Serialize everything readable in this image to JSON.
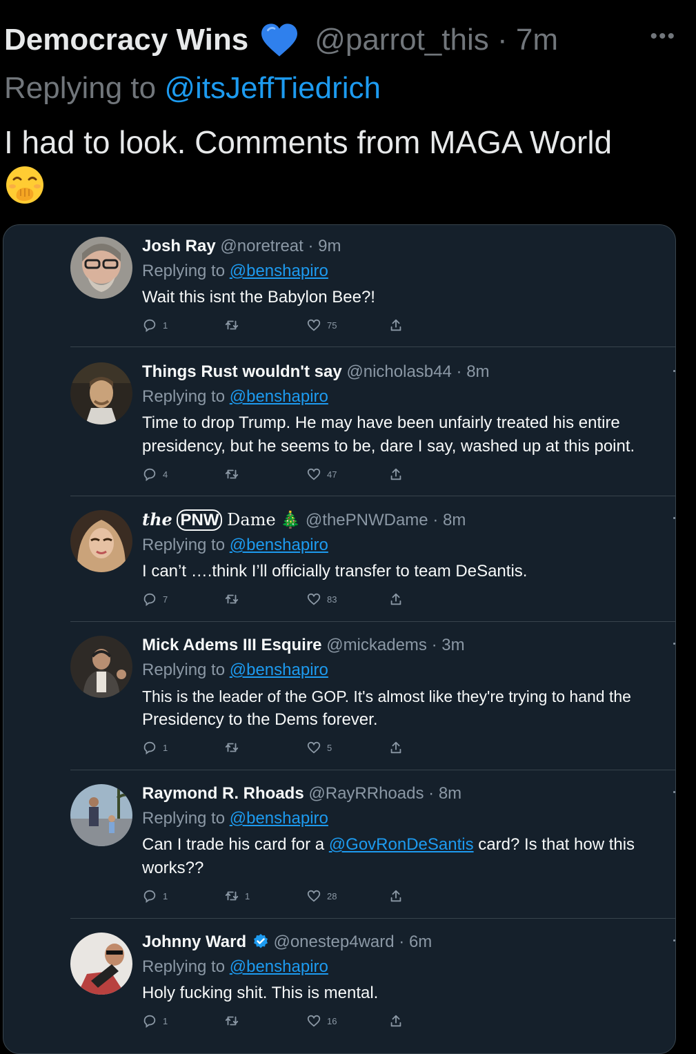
{
  "main_tweet": {
    "display_name": "Democracy Wins",
    "handle": "@parrot_this",
    "separator": "·",
    "time": "7m",
    "more": "•••",
    "replying_prefix": "Replying to",
    "replying_to": "@itsJeffTiedrich",
    "text": "I had to look. Comments from MAGA World",
    "heart_color": "#2f80ed",
    "emoji": "face-with-hand-over-mouth"
  },
  "replies": [
    {
      "name": "Josh Ray",
      "handle": "@noretreat",
      "time": "9m",
      "replying_prefix": "Replying to",
      "replying_to": "@benshapiro",
      "lines": [
        "Wait this isnt the Babylon Bee?!"
      ],
      "replies_count": "1",
      "retweets": "",
      "likes": "75"
    },
    {
      "name": "Things Rust wouldn't say",
      "handle": "@nicholasb44",
      "time": "8m",
      "replying_prefix": "Replying to",
      "replying_to": "@benshapiro",
      "lines": [
        "Time to drop Trump. He may have been unfairly treated his entire",
        "presidency, but he seems to be, dare I say,  washed up at this point."
      ],
      "replies_count": "4",
      "retweets": "",
      "likes": "47"
    },
    {
      "name_prefix": "the",
      "name_pnw": "PNW",
      "name_suffix": "Dame",
      "name_emoji": "🎄",
      "handle": "@thePNWDame",
      "time": "8m",
      "replying_prefix": "Replying to",
      "replying_to": "@benshapiro",
      "lines": [
        "I can’t ….think I’ll officially transfer to team DeSantis."
      ],
      "replies_count": "7",
      "retweets": "",
      "likes": "83"
    },
    {
      "name": "Mick Adems III Esquire",
      "handle": "@mickadems",
      "time": "3m",
      "replying_prefix": "Replying to",
      "replying_to": "@benshapiro",
      "lines": [
        "This is the leader of the GOP. It's almost like they're trying to hand the",
        "Presidency to the Dems forever."
      ],
      "replies_count": "1",
      "retweets": "",
      "likes": "5"
    },
    {
      "name": "Raymond R. Rhoads",
      "handle": "@RayRRhoads",
      "time": "8m",
      "replying_prefix": "Replying to",
      "replying_to": "@benshapiro",
      "line1_pre": "Can I trade his card for a ",
      "line1_mention": "@GovRonDeSantis",
      "line1_post": " card? Is that how this",
      "line2": "works??",
      "replies_count": "1",
      "retweets": "1",
      "likes": "28"
    },
    {
      "name": "Johnny Ward",
      "handle": "@onestep4ward",
      "time": "6m",
      "replying_prefix": "Replying to",
      "replying_to": "@benshapiro",
      "lines": [
        "Holy fucking shit. This is mental."
      ],
      "replies_count": "1",
      "retweets": "",
      "likes": "16"
    }
  ]
}
